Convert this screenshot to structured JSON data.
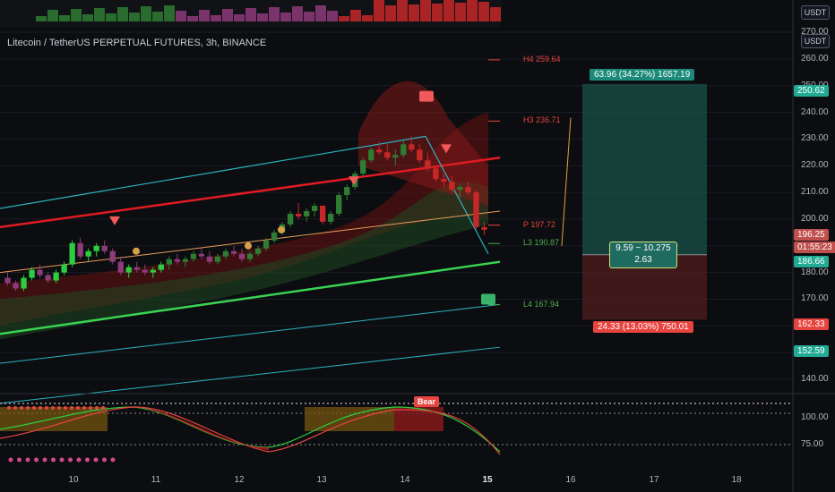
{
  "chart_data": {
    "type": "candlestick",
    "title": "Litecoin / TetherUS PERPETUAL FUTURES, 3h, BINANCE",
    "currency_label": "USDT",
    "y_ticks": [
      "270.00",
      "260.00",
      "250.00",
      "240.00",
      "230.00",
      "220.00",
      "210.00",
      "200.00",
      "190.00",
      "180.00",
      "170.00",
      "160.00",
      "150.00",
      "140.00"
    ],
    "x_ticks": [
      "10",
      "11",
      "12",
      "13",
      "14",
      "15",
      "16",
      "17",
      "18"
    ],
    "x_bold_tick": "15",
    "price_tags": [
      {
        "text": "250.62",
        "color": "#22ab94"
      },
      {
        "text": "196.25",
        "color": "#c0504d"
      },
      {
        "text": "01:55:23",
        "color": "#c0504d"
      },
      {
        "text": "186.66",
        "color": "#22ab94"
      },
      {
        "text": "162.33",
        "color": "#e8443f"
      },
      {
        "text": "152.59",
        "color": "#22ab94"
      }
    ],
    "pivots": [
      {
        "label": "H4 259.64",
        "color": "#e8443f"
      },
      {
        "label": "H3 236.71",
        "color": "#e8443f"
      },
      {
        "label": "P 197.72",
        "color": "#e8443f"
      },
      {
        "label": "L3 190.87",
        "color": "#4caf50"
      },
      {
        "label": "L4 167.94",
        "color": "#4caf50"
      }
    ],
    "position": {
      "target_label": "63.96 (34.27%) 1657.19",
      "stop_label": "24.33 (13.03%) 750.01",
      "ratio_line1": "9.59 ~ 10.275",
      "ratio_line2": "2.63",
      "entry": 186.66,
      "target": 250.62,
      "stop": 162.33
    },
    "oscillator": {
      "ticks": [
        "100.00",
        "75.00"
      ],
      "bear_label": "Bear"
    },
    "candles": [
      [
        178,
        180,
        175,
        176
      ],
      [
        176,
        177,
        173,
        174
      ],
      [
        174,
        179,
        173,
        178
      ],
      [
        178,
        182,
        177,
        181
      ],
      [
        181,
        183,
        178,
        179
      ],
      [
        179,
        180,
        176,
        177
      ],
      [
        177,
        181,
        176,
        180
      ],
      [
        180,
        184,
        179,
        183
      ],
      [
        183,
        192,
        182,
        191
      ],
      [
        191,
        193,
        185,
        186
      ],
      [
        186,
        189,
        184,
        188
      ],
      [
        188,
        191,
        186,
        190
      ],
      [
        190,
        192,
        187,
        188
      ],
      [
        188,
        189,
        183,
        184
      ],
      [
        184,
        186,
        179,
        180
      ],
      [
        180,
        183,
        178,
        182
      ],
      [
        182,
        184,
        180,
        181
      ],
      [
        181,
        183,
        179,
        180
      ],
      [
        180,
        182,
        178,
        181
      ],
      [
        181,
        184,
        180,
        183
      ],
      [
        183,
        186,
        181,
        185
      ],
      [
        185,
        187,
        183,
        184
      ],
      [
        184,
        186,
        182,
        185
      ],
      [
        185,
        188,
        184,
        187
      ],
      [
        187,
        189,
        185,
        186
      ],
      [
        186,
        188,
        183,
        184
      ],
      [
        184,
        187,
        183,
        186
      ],
      [
        186,
        189,
        185,
        188
      ],
      [
        188,
        190,
        186,
        187
      ],
      [
        187,
        189,
        184,
        185
      ],
      [
        185,
        188,
        184,
        187
      ],
      [
        187,
        190,
        186,
        189
      ],
      [
        189,
        193,
        188,
        192
      ],
      [
        192,
        196,
        191,
        195
      ],
      [
        195,
        199,
        194,
        198
      ],
      [
        198,
        203,
        197,
        202
      ],
      [
        202,
        206,
        200,
        201
      ],
      [
        201,
        204,
        199,
        203
      ],
      [
        203,
        206,
        201,
        205
      ],
      [
        205,
        205,
        198,
        199
      ],
      [
        199,
        203,
        198,
        202
      ],
      [
        202,
        210,
        201,
        209
      ],
      [
        209,
        213,
        207,
        212
      ],
      [
        212,
        218,
        211,
        217
      ],
      [
        217,
        223,
        216,
        222
      ],
      [
        222,
        227,
        221,
        226
      ],
      [
        226,
        229,
        224,
        225
      ],
      [
        225,
        228,
        222,
        223
      ],
      [
        223,
        226,
        220,
        224
      ],
      [
        224,
        230,
        223,
        228
      ],
      [
        228,
        231,
        225,
        226
      ],
      [
        226,
        228,
        221,
        222
      ],
      [
        222,
        225,
        218,
        219
      ],
      [
        219,
        220,
        214,
        215
      ],
      [
        215,
        217,
        212,
        214
      ],
      [
        214,
        216,
        210,
        211
      ],
      [
        211,
        213,
        208,
        212
      ],
      [
        212,
        214,
        209,
        210
      ],
      [
        210,
        211,
        196,
        197
      ],
      [
        197,
        199,
        194,
        196
      ]
    ]
  }
}
